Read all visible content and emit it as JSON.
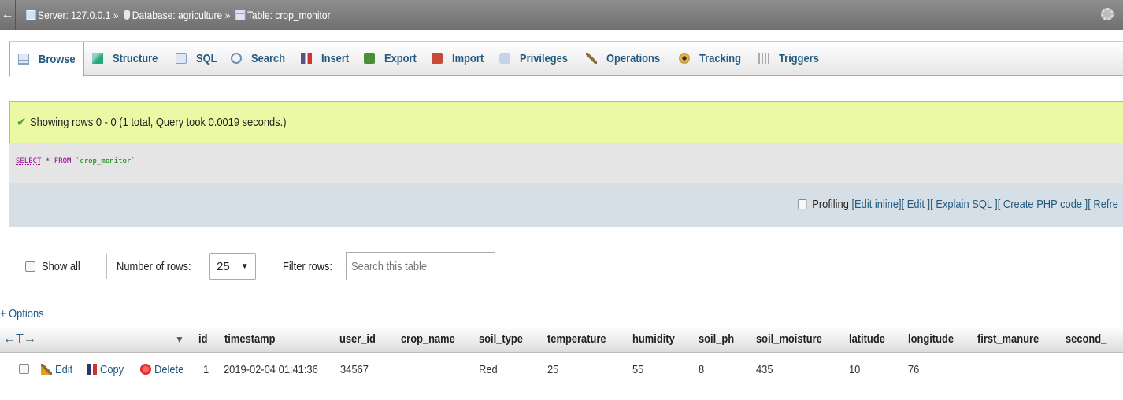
{
  "titlebar": {
    "back_icon": "left-arrow",
    "server_label": "Server: 127.0.0.1",
    "database_label": "Database: agriculture",
    "table_label": "Table: crop_monitor",
    "separator": "»",
    "settings_icon": "gear-icon"
  },
  "tabs": [
    {
      "label": "Browse",
      "icon": "browse-icon",
      "active": true
    },
    {
      "label": "Structure",
      "icon": "structure-icon"
    },
    {
      "label": "SQL",
      "icon": "sql-icon"
    },
    {
      "label": "Search",
      "icon": "search-icon"
    },
    {
      "label": "Insert",
      "icon": "insert-icon"
    },
    {
      "label": "Export",
      "icon": "export-icon"
    },
    {
      "label": "Import",
      "icon": "import-icon"
    },
    {
      "label": "Privileges",
      "icon": "privileges-icon"
    },
    {
      "label": "Operations",
      "icon": "operations-icon"
    },
    {
      "label": "Tracking",
      "icon": "tracking-icon"
    },
    {
      "label": "Triggers",
      "icon": "triggers-icon"
    }
  ],
  "message": {
    "text": "Showing rows 0 - 0 (1 total, Query took 0.0019 seconds.)",
    "color": "#ebf8a4"
  },
  "query": {
    "select": "SELECT",
    "star": " * ",
    "from": "FROM",
    "table": " `crop_monitor`"
  },
  "links": {
    "profiling": "Profiling",
    "edit_inline": "[Edit inline]",
    "edit": "[ Edit ]",
    "explain": "[ Explain SQL ]",
    "create_php": "[ Create PHP code ]",
    "refresh": "[ Refre"
  },
  "nav": {
    "show_all": "Show all",
    "rows_label": "Number of rows:",
    "rows_value": "25",
    "filter_label": "Filter rows:",
    "search_placeholder": "Search this table"
  },
  "options_label": "+ Options",
  "table": {
    "columns": [
      "id",
      "timestamp",
      "user_id",
      "crop_name",
      "soil_type",
      "temperature",
      "humidity",
      "soil_ph",
      "soil_moisture",
      "latitude",
      "longitude",
      "first_manure",
      "second_"
    ],
    "row_actions": {
      "edit": "Edit",
      "copy": "Copy",
      "delete": "Delete"
    },
    "rows": [
      [
        "1",
        "2019-02-04 01:41:36",
        "34567",
        "",
        "Red",
        "25",
        "55",
        "8",
        "435",
        "10",
        "76",
        "",
        ""
      ]
    ]
  }
}
